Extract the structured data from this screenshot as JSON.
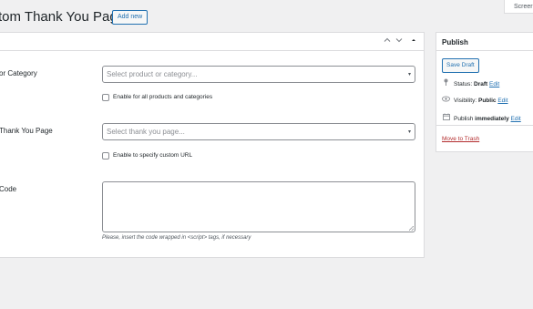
{
  "header": {
    "title": "tom Thank You Page",
    "add_new_label": "Add new",
    "screen_options_label": "Screer"
  },
  "fields": {
    "category": {
      "label": "or Category",
      "placeholder": "Select product or category...",
      "checkbox_label": "Enable for all products and categories"
    },
    "thank_you_page": {
      "label": "Thank You Page",
      "placeholder": "Select thank you page...",
      "checkbox_label": "Enable to specify custom URL"
    },
    "code": {
      "label": "Code",
      "hint": "Please, insert the code wrapped in <script> tags, if necessary"
    }
  },
  "publish": {
    "title": "Publish",
    "save_draft_label": "Save Draft",
    "status_label": "Status:",
    "status_value": "Draft",
    "visibility_label": "Visibility:",
    "visibility_value": "Public",
    "publish_label": "Publish",
    "publish_value": "immediately",
    "edit_label": "Edit",
    "trash_label": "Move to Trash"
  },
  "icons": {
    "collapse_up": "▴",
    "move_up": "⌃",
    "move_down": "⌄",
    "dropdown": "▾",
    "pin": "📍",
    "eye": "👁",
    "calendar": "📅"
  },
  "colors": {
    "link": "#2271b1",
    "trash": "#b32d2e",
    "background": "#f0f0f1"
  }
}
